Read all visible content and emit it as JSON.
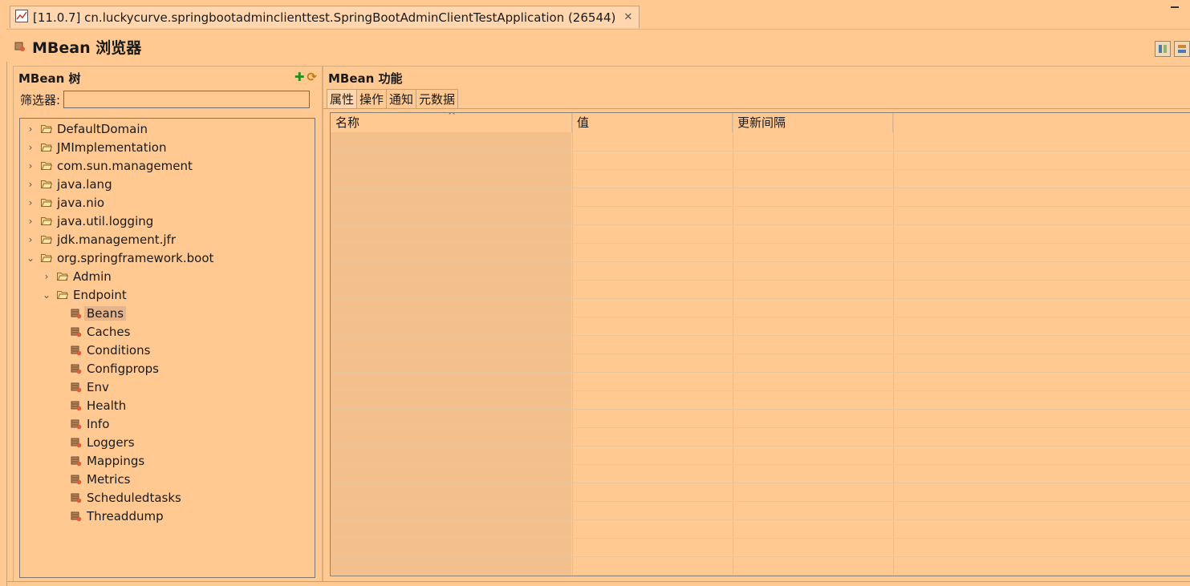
{
  "editor_tab": {
    "title": "[11.0.7] cn.luckycurve.springbootadminclienttest.SpringBootAdminClientTestApplication (26544)",
    "icon": "chart-icon",
    "close": "✕"
  },
  "header": {
    "title": "MBean 浏览器",
    "icon": "bean-icon"
  },
  "tree_panel": {
    "title": "MBean 树",
    "filter_label": "筛选器:",
    "filter_value": "",
    "add_icon": "✚",
    "refresh_icon": "⟳",
    "items": [
      {
        "label": "DefaultDomain",
        "level": 0,
        "kind": "folder",
        "state": "collapsed"
      },
      {
        "label": "JMImplementation",
        "level": 0,
        "kind": "folder",
        "state": "collapsed"
      },
      {
        "label": "com.sun.management",
        "level": 0,
        "kind": "folder",
        "state": "collapsed"
      },
      {
        "label": "java.lang",
        "level": 0,
        "kind": "folder",
        "state": "collapsed"
      },
      {
        "label": "java.nio",
        "level": 0,
        "kind": "folder",
        "state": "collapsed"
      },
      {
        "label": "java.util.logging",
        "level": 0,
        "kind": "folder",
        "state": "collapsed"
      },
      {
        "label": "jdk.management.jfr",
        "level": 0,
        "kind": "folder",
        "state": "collapsed"
      },
      {
        "label": "org.springframework.boot",
        "level": 0,
        "kind": "folder",
        "state": "expanded"
      },
      {
        "label": "Admin",
        "level": 1,
        "kind": "folder",
        "state": "collapsed"
      },
      {
        "label": "Endpoint",
        "level": 1,
        "kind": "folder",
        "state": "expanded"
      },
      {
        "label": "Beans",
        "level": 2,
        "kind": "bean",
        "selected": true
      },
      {
        "label": "Caches",
        "level": 2,
        "kind": "bean"
      },
      {
        "label": "Conditions",
        "level": 2,
        "kind": "bean"
      },
      {
        "label": "Configprops",
        "level": 2,
        "kind": "bean"
      },
      {
        "label": "Env",
        "level": 2,
        "kind": "bean"
      },
      {
        "label": "Health",
        "level": 2,
        "kind": "bean"
      },
      {
        "label": "Info",
        "level": 2,
        "kind": "bean"
      },
      {
        "label": "Loggers",
        "level": 2,
        "kind": "bean"
      },
      {
        "label": "Mappings",
        "level": 2,
        "kind": "bean"
      },
      {
        "label": "Metrics",
        "level": 2,
        "kind": "bean"
      },
      {
        "label": "Scheduledtasks",
        "level": 2,
        "kind": "bean"
      },
      {
        "label": "Threaddump",
        "level": 2,
        "kind": "bean"
      }
    ]
  },
  "features_panel": {
    "title": "MBean 功能",
    "tabs": [
      "属性",
      "操作",
      "通知",
      "元数据"
    ],
    "active_tab": "属性",
    "columns": [
      "名称",
      "值",
      "更新间隔"
    ],
    "sort_indicator": "^",
    "rows": []
  }
}
